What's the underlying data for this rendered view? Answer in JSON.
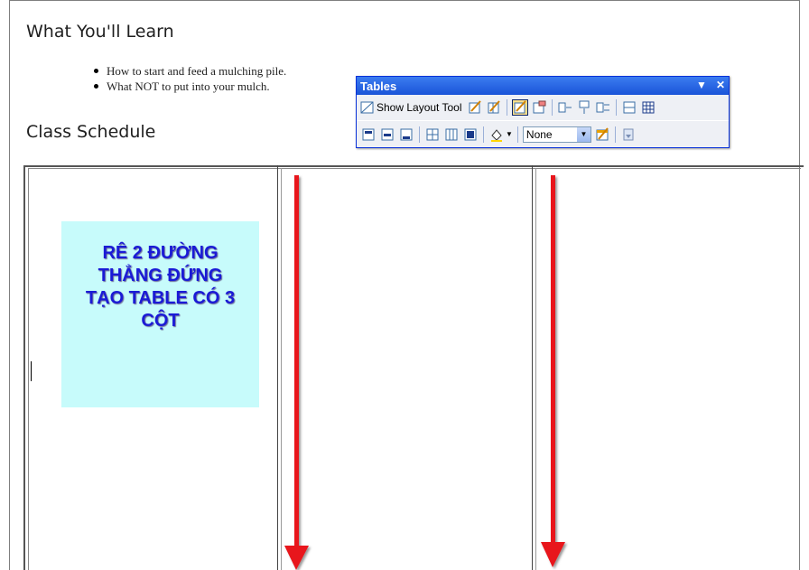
{
  "headings": {
    "learn": "What You'll Learn",
    "schedule": "Class Schedule"
  },
  "bullets": [
    "How to start and feed a mulching pile.",
    "What NOT to put into your mulch."
  ],
  "note": {
    "text": "RÊ 2 ĐƯỜNG\nTHẲNG ĐỨNG\nTẠO TABLE CÓ 3\nCỘT",
    "bg_color": "#c7fbfb",
    "text_color": "#1a1ad6"
  },
  "arrows": {
    "color": "#e8141c"
  },
  "toolbar": {
    "title": "Tables",
    "dropdown_icon": "▼",
    "close_icon": "✕",
    "show_layout_label": "Show Layout Tool",
    "cell_format_value": "None",
    "accent": "#0831d9"
  }
}
